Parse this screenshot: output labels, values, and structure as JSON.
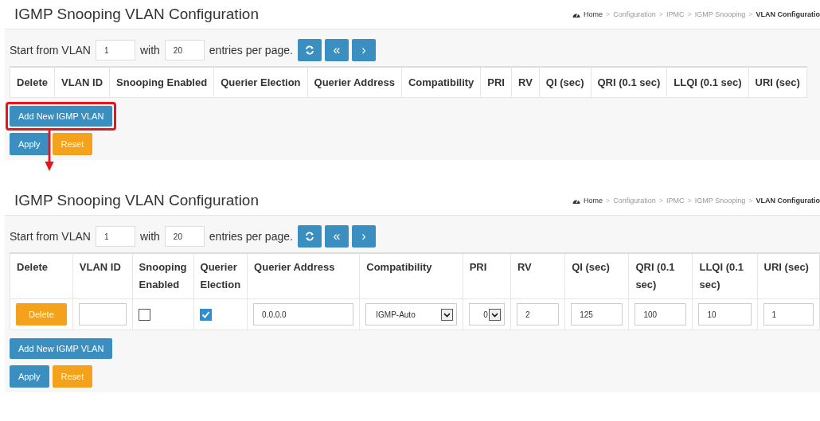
{
  "panels": [
    {
      "title": "IGMP Snooping VLAN Configuration",
      "breadcrumb": [
        {
          "label": "Home",
          "current": false
        },
        {
          "label": "Configuration",
          "current": false
        },
        {
          "label": "IPMC",
          "current": false
        },
        {
          "label": "IGMP Snooping",
          "current": false
        },
        {
          "label": "VLAN Configuratio",
          "current": true
        }
      ],
      "breadcrumb_separator": ">",
      "paging": {
        "start_label": "Start from VLAN",
        "start_value": "1",
        "with_label": "with",
        "entries_value": "20",
        "entries_label": "entries per page.",
        "first_label": "«",
        "next_label": "›"
      },
      "columns": [
        "Delete",
        "VLAN ID",
        "Snooping Enabled",
        "Querier Election",
        "Querier Address",
        "Compatibility",
        "PRI",
        "RV",
        "QI (sec)",
        "QRI (0.1 sec)",
        "LLQI (0.1 sec)",
        "URI (sec)"
      ],
      "add_button": {
        "label": "Add New IGMP VLAN",
        "highlighted": true
      },
      "apply_label": "Apply",
      "reset_label": "Reset"
    },
    {
      "title": "IGMP Snooping VLAN Configuration",
      "breadcrumb": [
        {
          "label": "Home",
          "current": false
        },
        {
          "label": "Configuration",
          "current": false
        },
        {
          "label": "IPMC",
          "current": false
        },
        {
          "label": "IGMP Snooping",
          "current": false
        },
        {
          "label": "VLAN Configuratio",
          "current": true
        }
      ],
      "breadcrumb_separator": ">",
      "paging": {
        "start_label": "Start from VLAN",
        "start_value": "1",
        "with_label": "with",
        "entries_value": "20",
        "entries_label": "entries per page.",
        "first_label": "«",
        "next_label": "›"
      },
      "columns": [
        "Delete",
        "VLAN ID",
        "Snooping Enabled",
        "Querier Election",
        "Querier Address",
        "Compatibility",
        "PRI",
        "RV",
        "QI (sec)",
        "QRI (0.1 sec)",
        "LLQI (0.1 sec)",
        "URI (sec)"
      ],
      "rows": [
        {
          "cells": [
            {
              "kind": "button",
              "label": "Delete"
            },
            {
              "kind": "input"
            },
            {
              "kind": "checkbox",
              "checked": false
            },
            {
              "kind": "checkbox",
              "checked": true
            },
            {
              "kind": "input",
              "value": "0.0.0.0"
            },
            {
              "kind": "select",
              "value": "IGMP-Auto"
            },
            {
              "kind": "select",
              "value": "0"
            },
            {
              "kind": "input",
              "value": "2"
            },
            {
              "kind": "input",
              "value": "125"
            },
            {
              "kind": "input",
              "value": "100"
            },
            {
              "kind": "input",
              "value": "10"
            },
            {
              "kind": "input",
              "value": "1"
            }
          ]
        }
      ],
      "add_button": {
        "label": "Add New IGMP VLAN",
        "highlighted": false
      },
      "apply_label": "Apply",
      "reset_label": "Reset"
    }
  ]
}
